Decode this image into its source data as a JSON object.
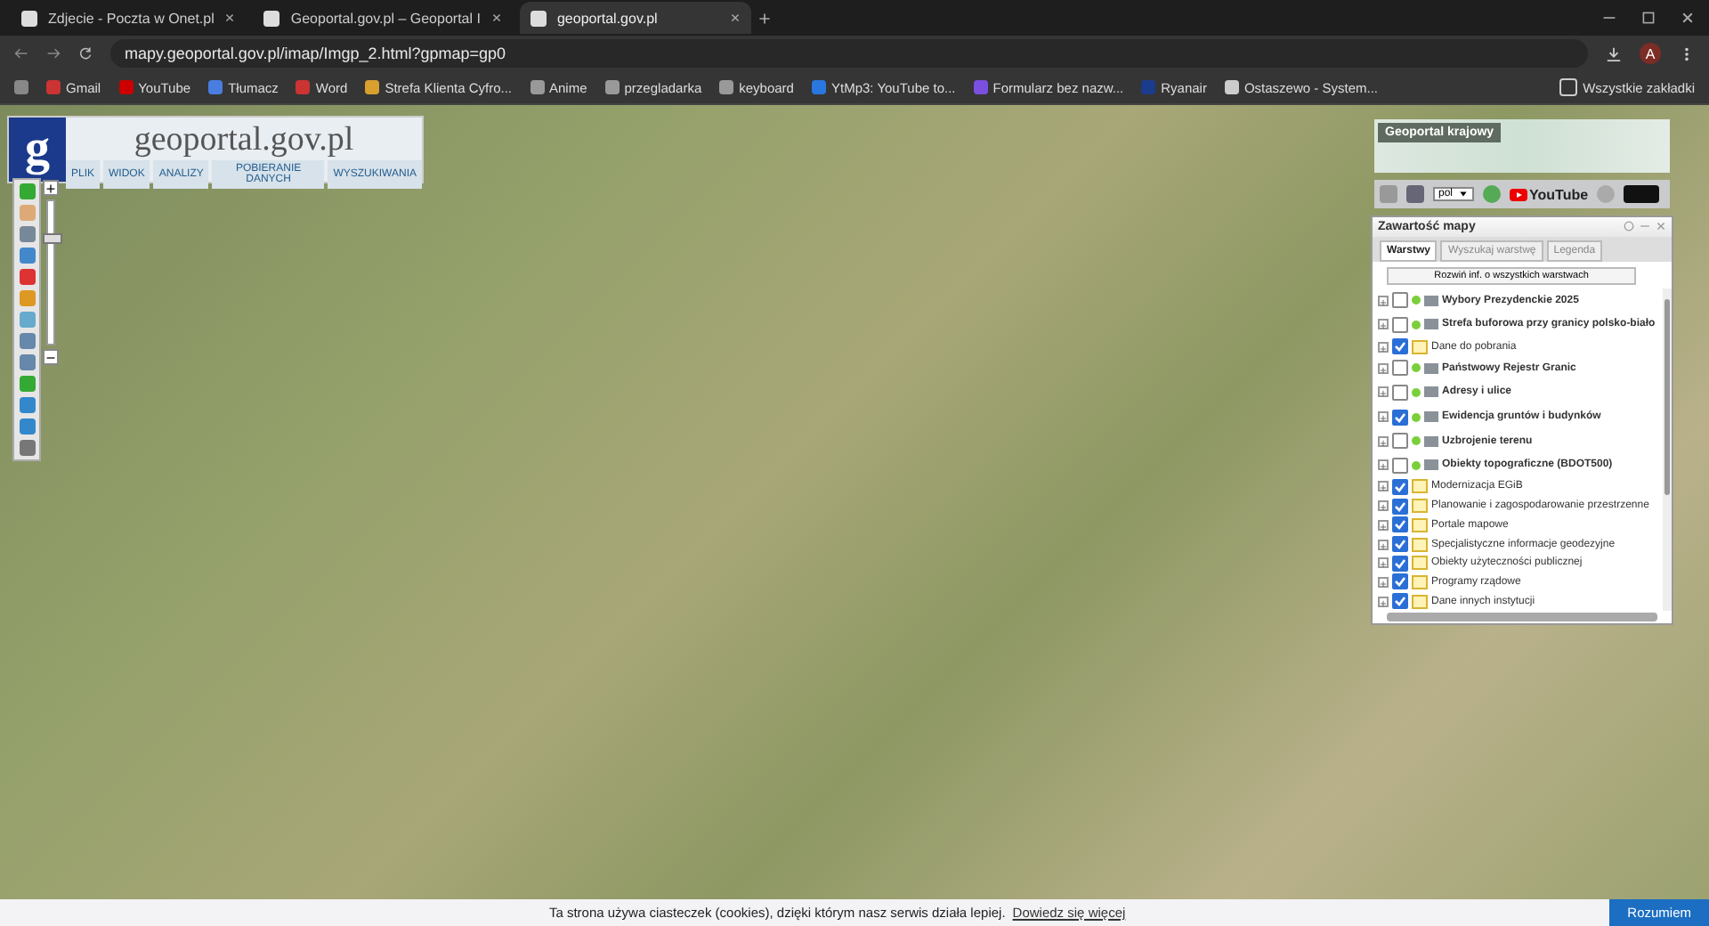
{
  "browser": {
    "tabs": [
      {
        "title": "Zdjecie - Poczta w Onet.pl",
        "selected": false
      },
      {
        "title": "Geoportal.gov.pl – Geoportal I",
        "selected": false
      },
      {
        "title": "geoportal.gov.pl",
        "selected": true
      }
    ],
    "url": "mapy.geoportal.gov.pl/imap/Imgp_2.html?gpmap=gp0",
    "avatar": "A",
    "bookmarks": [
      "Gmail",
      "YouTube",
      "Tłumacz",
      "Word",
      "Strefa Klienta Cyfro...",
      "Anime",
      "przegladarka",
      "keyboard",
      "YtMp3: YouTube to...",
      "Formularz bez nazw...",
      "Ryanair",
      "Ostaszewo - System..."
    ],
    "all_bookmarks": "Wszystkie zakładki"
  },
  "geoportal": {
    "logo": "g",
    "site": "geoportal.gov.pl",
    "menu": [
      "PLIK",
      "WIDOK",
      "ANALIZY",
      "POBIERANIE DANYCH",
      "WYSZUKIWANIA"
    ],
    "zoom": {
      "plus": "+",
      "minus": "−",
      "level": 0.74
    },
    "overview": {
      "title": "Geoportal krajowy"
    },
    "language": "pol",
    "youtube": "YouTube",
    "panel": {
      "title": "Zawartość mapy",
      "tabs": [
        {
          "label": "Warstwy",
          "selected": true
        },
        {
          "label": "Wyszukaj warstwę",
          "selected": false
        },
        {
          "label": "Legenda",
          "selected": false
        }
      ],
      "expand_button": "Rozwiń inf. o wszystkich warstwach",
      "layers": [
        {
          "kind": "service",
          "label": "Wybory Prezydenckie 2025",
          "checked": false
        },
        {
          "kind": "service",
          "label": "Strefa buforowa przy granicy polsko-biało",
          "checked": false
        },
        {
          "kind": "folder",
          "label": "Dane do pobrania",
          "checked": true
        },
        {
          "kind": "service",
          "label": "Państwowy Rejestr Granic",
          "checked": false
        },
        {
          "kind": "service",
          "label": "Adresy i ulice",
          "checked": false
        },
        {
          "kind": "service",
          "label": "Ewidencja gruntów i budynków",
          "checked": true
        },
        {
          "kind": "service",
          "label": "Uzbrojenie terenu",
          "checked": false
        },
        {
          "kind": "service",
          "label": "Obiekty topograficzne (BDOT500)",
          "checked": false
        },
        {
          "kind": "folder",
          "label": "Modernizacja EGiB",
          "checked": true
        },
        {
          "kind": "folder",
          "label": "Planowanie i zagospodarowanie przestrzenne",
          "checked": true
        },
        {
          "kind": "folder",
          "label": "Portale mapowe",
          "checked": true
        },
        {
          "kind": "folder",
          "label": "Specjalistyczne informacje geodezyjne",
          "checked": true
        },
        {
          "kind": "folder",
          "label": "Obiekty użyteczności publicznej",
          "checked": true
        },
        {
          "kind": "folder",
          "label": "Programy rządowe",
          "checked": true
        },
        {
          "kind": "folder",
          "label": "Dane innych instytucji",
          "checked": true
        }
      ]
    }
  },
  "cookie_bar": {
    "text": "Ta strona używa ciasteczek (cookies), dzięki którym nasz serwis działa lepiej.",
    "link": "Dowiedz się więcej",
    "button": "Rozumiem"
  }
}
